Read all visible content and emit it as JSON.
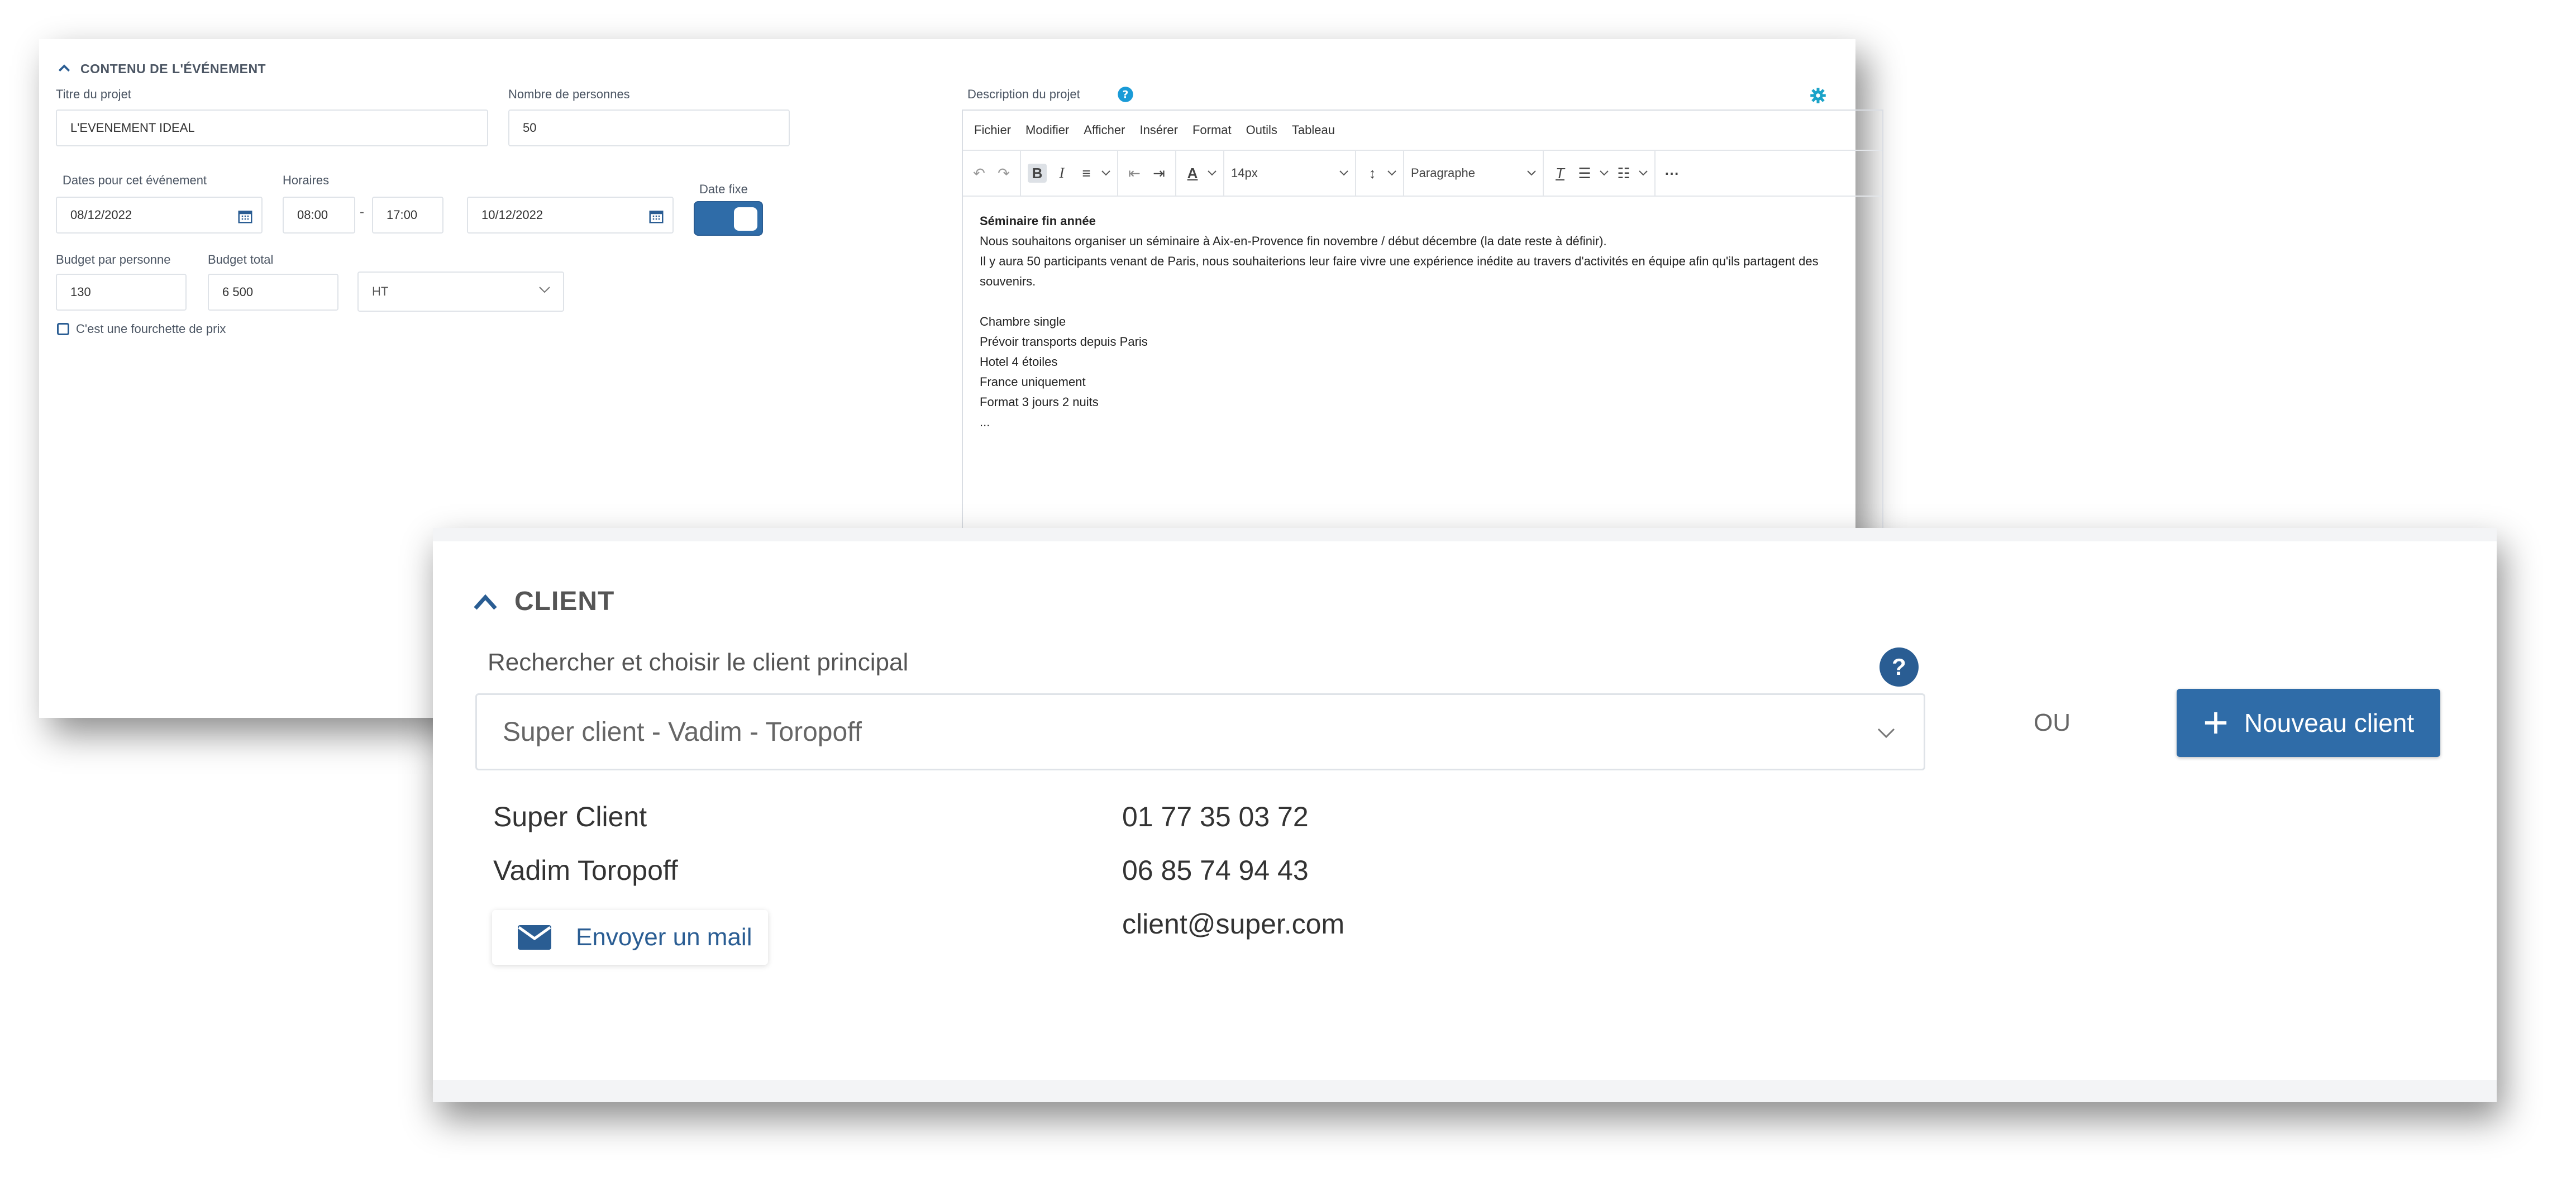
{
  "event": {
    "section_title": "CONTENU DE L'ÉVÉNEMENT",
    "title_label": "Titre du projet",
    "title_value": "L'EVENEMENT IDEAL",
    "people_label": "Nombre de personnes",
    "people_value": "50",
    "dates_label": "Dates pour cet événement",
    "start_date": "08/12/2022",
    "hours_label": "Horaires",
    "start_time": "08:00",
    "time_sep": "-",
    "end_time": "17:00",
    "end_date": "10/12/2022",
    "fixed_date_label": "Date fixe",
    "fixed_date_on": true,
    "budget_pp_label": "Budget par personne",
    "budget_pp_value": "130",
    "budget_total_label": "Budget total",
    "budget_total_value": "6 500",
    "tax_value": "HT",
    "range_label": "C'est une fourchette de prix"
  },
  "editor": {
    "label": "Description du projet",
    "menu": [
      "Fichier",
      "Modifier",
      "Afficher",
      "Insérer",
      "Format",
      "Outils",
      "Tableau"
    ],
    "font_size": "14px",
    "block_format": "Paragraphe",
    "content": {
      "heading": "Séminaire fin année",
      "lines": [
        "Nous souhaitons organiser un séminaire à Aix-en-Provence fin novembre / début décembre (la date reste à définir).",
        "Il y aura 50 participants venant de Paris, nous souhaiterions leur faire vivre une expérience inédite au travers d'activités en équipe afin qu'ils partagent des souvenirs.",
        "",
        "Chambre single",
        "Prévoir transports depuis Paris",
        "Hotel 4 étoiles",
        "France uniquement",
        "Format 3 jours 2 nuits",
        "..."
      ]
    }
  },
  "client": {
    "section_title": "CLIENT",
    "search_label": "Rechercher et choisir le client principal",
    "help": "?",
    "selected": "Super client - Vadim - Toropoff",
    "or_label": "OU",
    "new_button": "Nouveau client",
    "company": "Super Client",
    "contact_name": "Vadim Toropoff",
    "phone_1": "01 77 35 03 72",
    "phone_2": "06 85 74 94 43",
    "email": "client@super.com",
    "mail_button": "Envoyer un mail"
  },
  "colors": {
    "accent": "#2f6ca8",
    "help_icon": "#1a9bd7",
    "gear": "#1aa3c8"
  }
}
